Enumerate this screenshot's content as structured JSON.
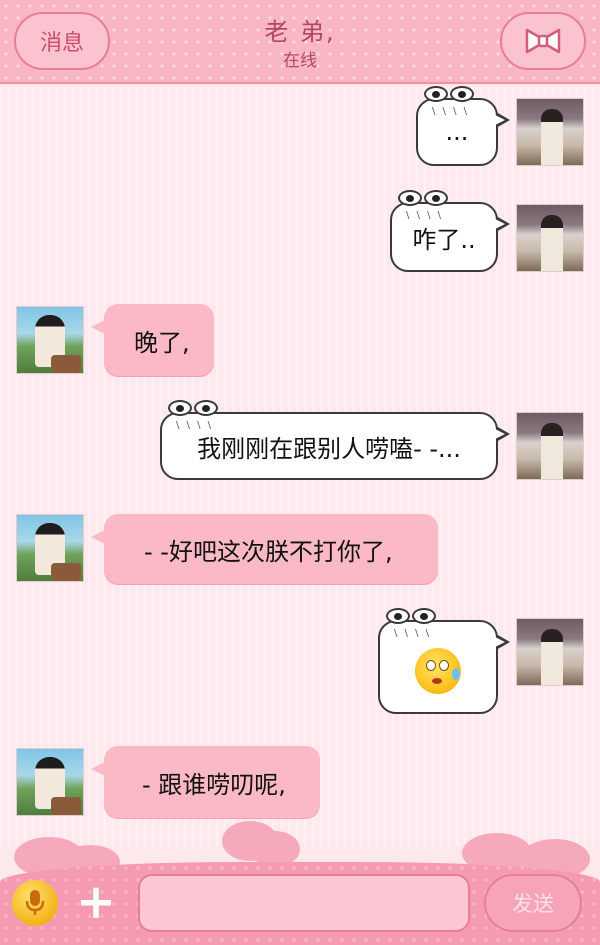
{
  "header": {
    "back_label": "消息",
    "title": "老 弟,",
    "status": "在线",
    "profile_icon": "bow-icon"
  },
  "messages": [
    {
      "side": "out",
      "text": "..."
    },
    {
      "side": "out",
      "text": "咋了.."
    },
    {
      "side": "in",
      "text": "晚了,"
    },
    {
      "side": "out",
      "text": "我刚刚在跟别人唠嗑- -..."
    },
    {
      "side": "in",
      "text": "- -好吧这次朕不打你了,"
    },
    {
      "side": "out",
      "text": "",
      "emoji": "sweat-smile-emoji"
    },
    {
      "side": "in",
      "text": "- 跟谁唠叨呢,"
    }
  ],
  "input": {
    "value": "",
    "placeholder": "",
    "send_label": "发送",
    "mic_icon": "microphone-icon",
    "plus_icon": "plus-icon"
  },
  "colors": {
    "header_bg": "#f9b6c5",
    "chat_bg": "#fde9ee",
    "incoming_bubble": "#fbb9c6",
    "accent": "#e77e96"
  }
}
